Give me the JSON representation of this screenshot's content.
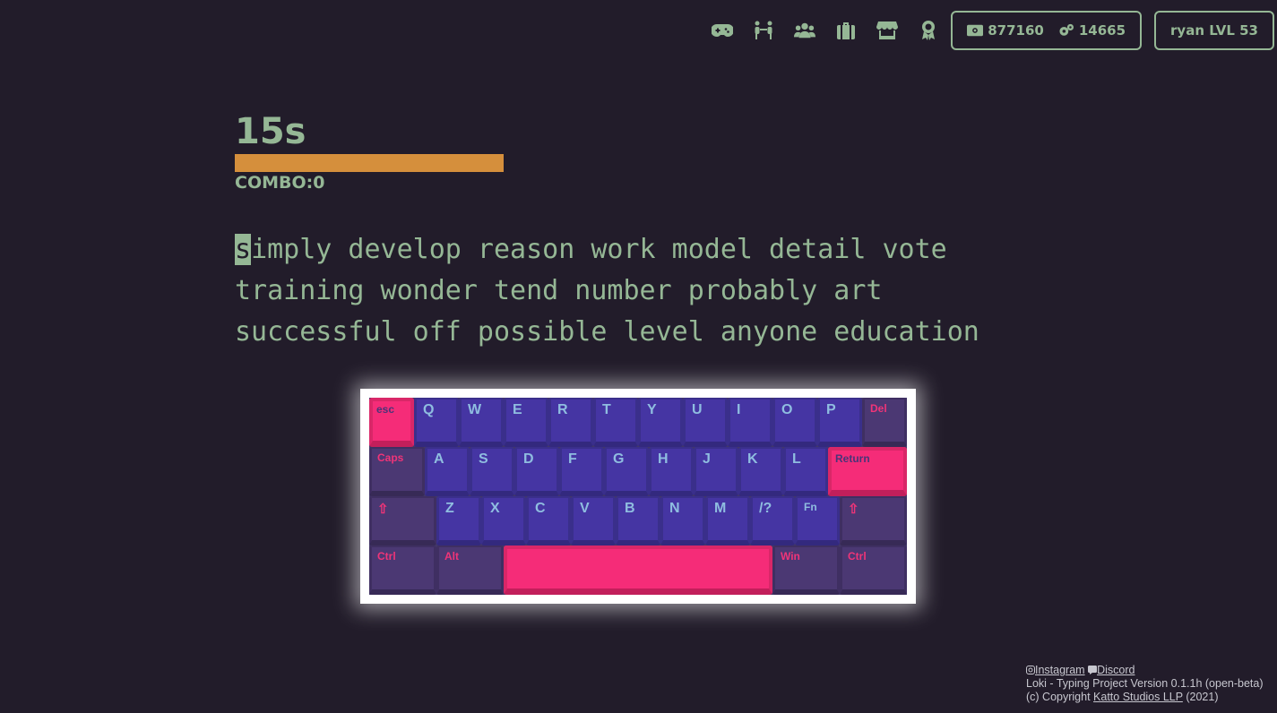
{
  "topbar": {
    "icons": [
      "gamepad-icon",
      "multiplayer-icon",
      "users-icon",
      "inventory-icon",
      "store-icon",
      "award-icon"
    ],
    "money": "877160",
    "gears": "14665",
    "user": "ryan LVL 53"
  },
  "game": {
    "timer": "15s",
    "timer_progress": 1.0,
    "combo": "COMBO:0",
    "caret_char": "s",
    "text_rest": "imply develop reason work model detail vote training wonder tend number probably art successful off possible level anyone education"
  },
  "keyboard": {
    "row1": [
      "esc",
      "Q",
      "W",
      "E",
      "R",
      "T",
      "Y",
      "U",
      "I",
      "O",
      "P",
      "Del"
    ],
    "row2": [
      "Caps",
      "A",
      "S",
      "D",
      "F",
      "G",
      "H",
      "J",
      "K",
      "L",
      "Return"
    ],
    "row3": [
      "⇧",
      "Z",
      "X",
      "C",
      "V",
      "B",
      "N",
      "M",
      "/?",
      "Fn",
      "⇧"
    ],
    "row4": [
      "Ctrl",
      "Alt",
      "",
      "Win",
      "Ctrl"
    ]
  },
  "footer": {
    "instagram": "Instagram",
    "discord": "Discord",
    "version": "Loki - Typing Project Version 0.1.1h (open-beta)",
    "copyright_prefix": "(c) Copyright ",
    "company": "Katto Studios LLP",
    "copyright_suffix": " (2021)"
  },
  "colors": {
    "background": "#221c2a",
    "text": "#95b795",
    "accent_bar": "#d58f3c",
    "key_letter": "#4535a3",
    "key_mod": "#4b3873",
    "key_hot": "#f52c78"
  }
}
